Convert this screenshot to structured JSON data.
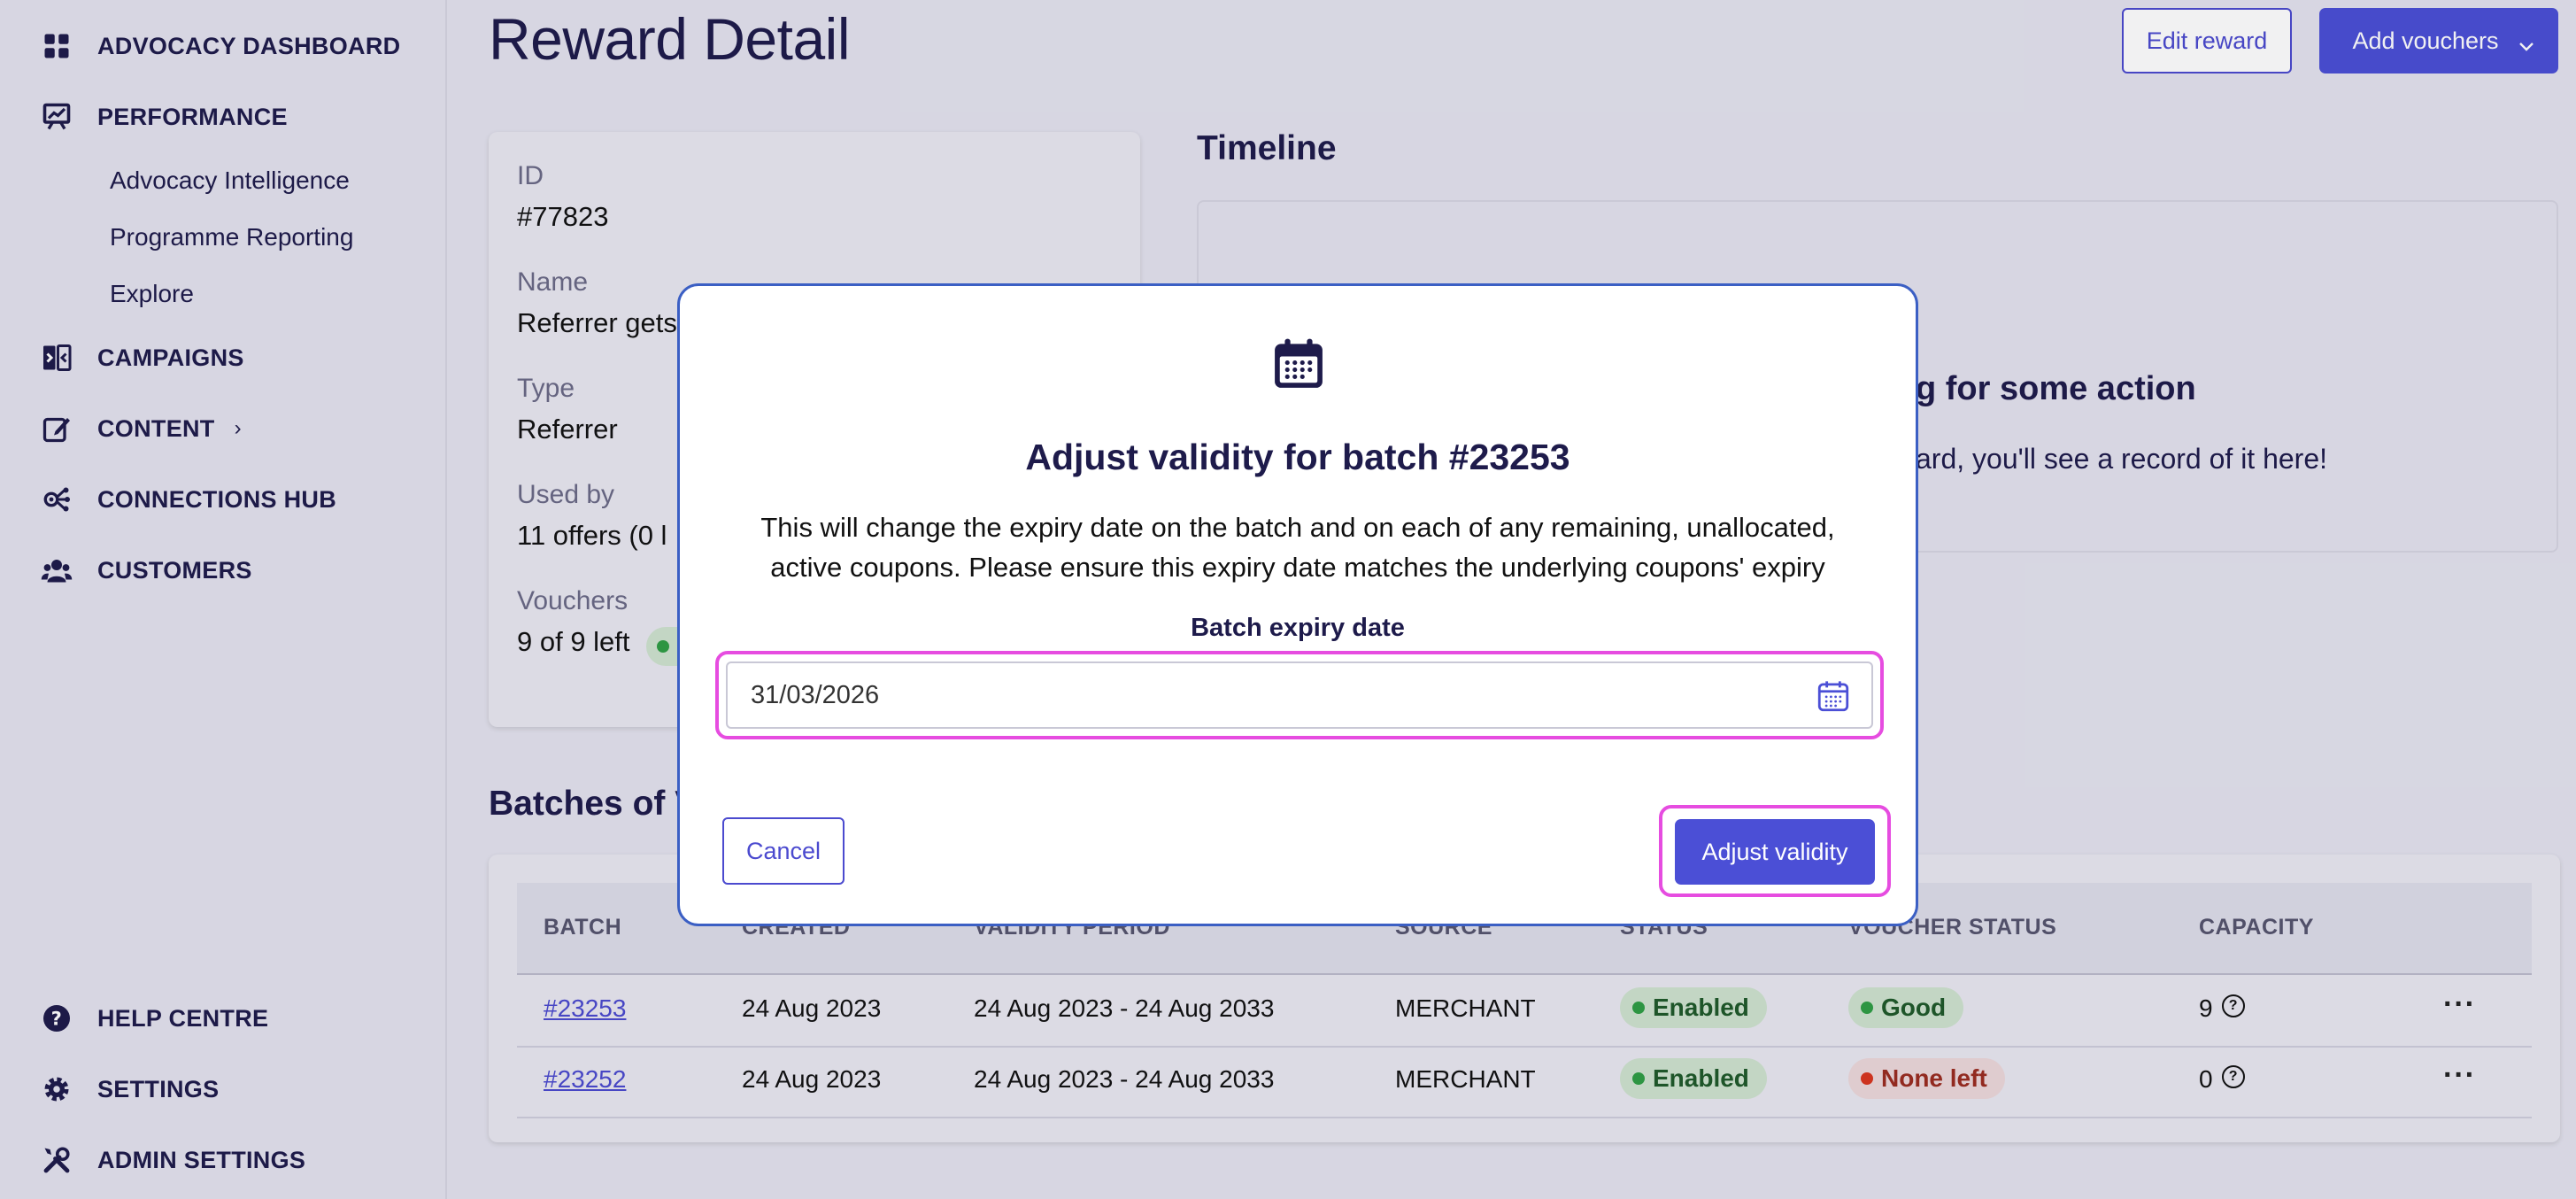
{
  "sidebar": {
    "nav": [
      {
        "label": "ADVOCACY DASHBOARD",
        "icon": "grid-icon"
      },
      {
        "label": "PERFORMANCE",
        "icon": "presentation-chart-icon"
      },
      {
        "label": "CAMPAIGNS",
        "icon": "campaigns-icon"
      },
      {
        "label": "CONTENT",
        "icon": "edit-icon",
        "chevron": "›"
      },
      {
        "label": "CONNECTIONS HUB",
        "icon": "connections-icon"
      },
      {
        "label": "CUSTOMERS",
        "icon": "users-icon"
      }
    ],
    "performance_sub": [
      "Advocacy Intelligence",
      "Programme Reporting",
      "Explore"
    ],
    "bottom": [
      {
        "label": "HELP CENTRE",
        "icon": "help-icon"
      },
      {
        "label": "SETTINGS",
        "icon": "gear-icon"
      },
      {
        "label": "ADMIN SETTINGS",
        "icon": "tools-icon"
      }
    ]
  },
  "header": {
    "title": "Reward Detail",
    "edit_label": "Edit reward",
    "add_label": "Add vouchers"
  },
  "details": {
    "id_label": "ID",
    "id_value": "#77823",
    "name_label": "Name",
    "name_value": "Referrer gets",
    "type_label": "Type",
    "type_value": "Referrer",
    "used_label": "Used by",
    "used_value": "11 offers (0 l",
    "vouchers_label": "Vouchers",
    "vouchers_value": "9 of 9 left"
  },
  "timeline": {
    "title": "Timeline",
    "empty_title": "g for some action",
    "empty_text": "ard, you'll see a record of it here!"
  },
  "batches": {
    "title": "Batches of V",
    "columns": [
      "BATCH",
      "CREATED",
      "VALIDITY PERIOD",
      "SOURCE",
      "STATUS",
      "VOUCHER STATUS",
      "CAPACITY"
    ],
    "rows": [
      {
        "batch": "#23253",
        "created": "24 Aug 2023",
        "validity": "24 Aug 2023 - 24 Aug 2033",
        "source": "MERCHANT",
        "status": "Enabled",
        "voucher_status": "Good",
        "capacity": "9"
      },
      {
        "batch": "#23252",
        "created": "24 Aug 2023",
        "validity": "24 Aug 2023 - 24 Aug 2033",
        "source": "MERCHANT",
        "status": "Enabled",
        "voucher_status": "None left",
        "capacity": "0"
      }
    ]
  },
  "modal": {
    "icon": "calendar-icon",
    "title": "Adjust validity for batch #23253",
    "description_line1": "This will change the expiry date on the batch and on each of any remaining, unallocated,",
    "description_line2": "active coupons. Please ensure this expiry date matches the underlying coupons' expiry",
    "date_label": "Batch expiry date",
    "date_value": "31/03/2026",
    "cancel_label": "Cancel",
    "confirm_label": "Adjust validity"
  },
  "colors": {
    "accent": "#4b4fd6",
    "highlight": "#e64ce0",
    "good": "#2f9e44",
    "none_left": "#d9361f"
  }
}
